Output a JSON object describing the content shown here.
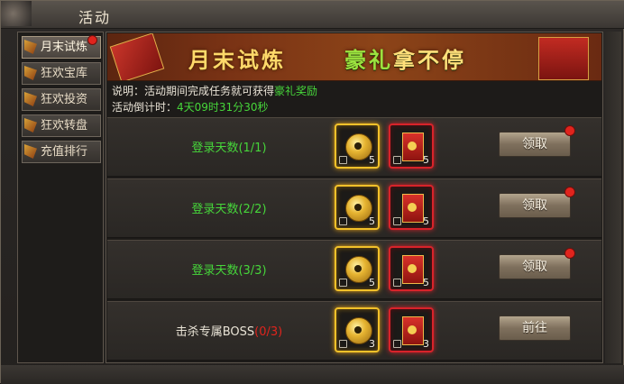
{
  "window": {
    "title": "活动",
    "close_glyph": ""
  },
  "sidebar": {
    "items": [
      {
        "label": "月末试炼",
        "active": true,
        "dot": true
      },
      {
        "label": "狂欢宝库",
        "active": false,
        "dot": false
      },
      {
        "label": "狂欢投资",
        "active": false,
        "dot": false
      },
      {
        "label": "狂欢转盘",
        "active": false,
        "dot": false
      },
      {
        "label": "充值排行",
        "active": false,
        "dot": false
      }
    ]
  },
  "banner": {
    "title_a": "月末试炼",
    "title_b_green": "豪礼",
    "title_b_gold": "拿不停"
  },
  "info": {
    "desc_prefix": "说明：活动期间完成任务就可获得",
    "desc_reward": "豪礼奖励",
    "countdown_label": "活动倒计时：",
    "countdown_value": "4天09时31分30秒"
  },
  "rows": [
    {
      "label": "登录天数(1/1)",
      "coin_count": "5",
      "envelope_count": "5",
      "button": "领取",
      "dot": true
    },
    {
      "label": "登录天数(2/2)",
      "coin_count": "5",
      "envelope_count": "5",
      "button": "领取",
      "dot": true
    },
    {
      "label": "登录天数(3/3)",
      "coin_count": "5",
      "envelope_count": "5",
      "button": "领取",
      "dot": true
    },
    {
      "label_prefix": "击杀专属BOSS",
      "label_progress": "(0/3)",
      "coin_count": "3",
      "envelope_count": "3",
      "button": "前往",
      "dot": false
    }
  ],
  "colors": {
    "accent_green": "#46d63a",
    "notify_red": "#e0241d",
    "gold_border": "#f2c12a"
  }
}
